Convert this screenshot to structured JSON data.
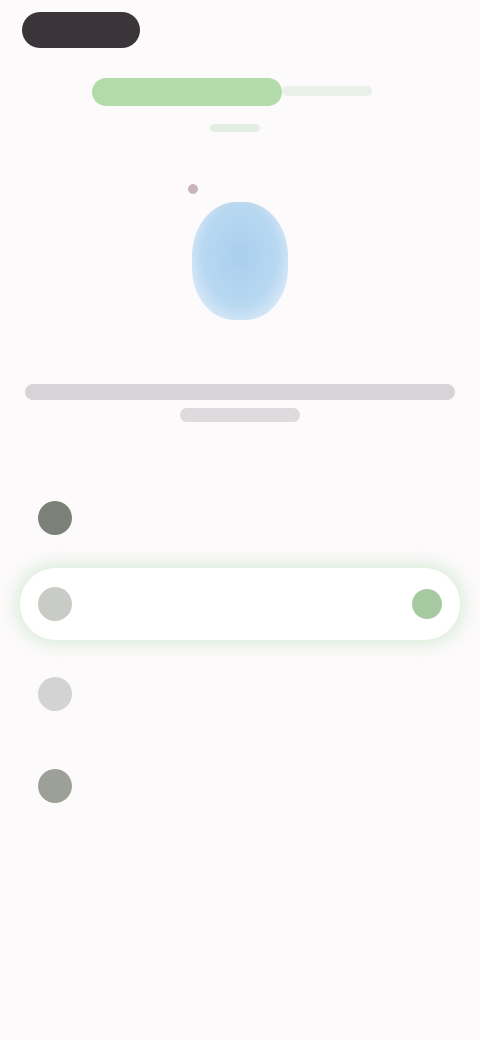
{
  "header": {
    "back_label": "",
    "title": ""
  },
  "description": "",
  "options": [
    {
      "label": ""
    },
    {
      "label": ""
    },
    {
      "label": ""
    },
    {
      "label": ""
    }
  ],
  "colors": {
    "accent": "#a8d8a0",
    "illustration": "#a9cfee",
    "background": "#fdfafc"
  },
  "icons": {
    "back": "back-icon",
    "illustration": "device-icon",
    "option": "option-icon",
    "selected": "check-icon"
  }
}
